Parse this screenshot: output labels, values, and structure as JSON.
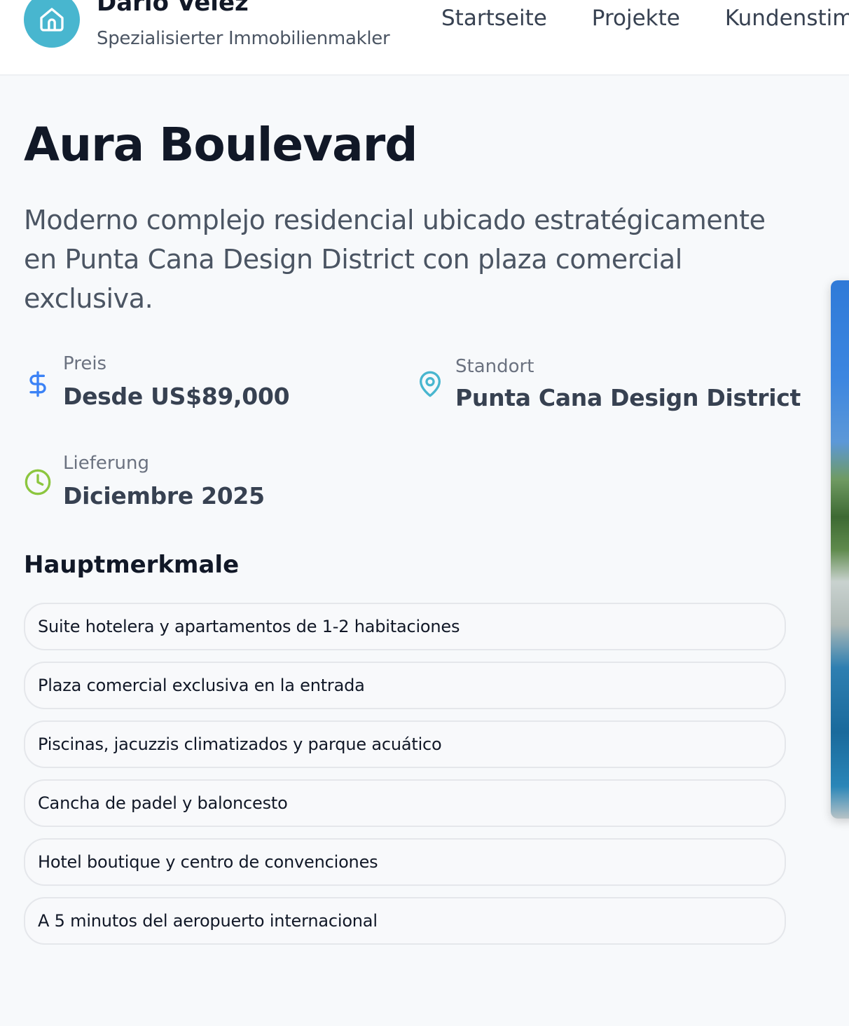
{
  "header": {
    "brand_name": "Dario Velez",
    "brand_subtitle": "Spezialisierter Immobilienmakler",
    "logo_icon": "home-icon",
    "brand_color": "#48b6cf",
    "nav": [
      {
        "label": "Startseite"
      },
      {
        "label": "Projekte"
      },
      {
        "label": "Kundenstim"
      }
    ]
  },
  "project": {
    "title": "Aura Boulevard",
    "description": "Moderno complejo residencial ubicado estratégicamente en Punta Cana Design District con plaza comercial exclusiva.",
    "price": {
      "label": "Preis",
      "value": "Desde US$89,000",
      "icon": "dollar-icon",
      "color": "#3b82f6"
    },
    "location": {
      "label": "Standort",
      "value": "Punta Cana Design District",
      "icon": "map-pin-icon",
      "color": "#48b6cf"
    },
    "delivery": {
      "label": "Lieferung",
      "value": "Diciembre 2025",
      "icon": "clock-icon",
      "color": "#8cc63f"
    }
  },
  "features": {
    "title": "Hauptmerkmale",
    "items": [
      "Suite hotelera y apartamentos de 1-2 habitaciones",
      "Plaza comercial exclusiva en la entrada",
      "Piscinas, jacuzzis climatizados y parque acuático",
      "Cancha de padel y baloncesto",
      "Hotel boutique y centro de convenciones",
      "A 5 minutos del aeropuerto internacional"
    ]
  }
}
